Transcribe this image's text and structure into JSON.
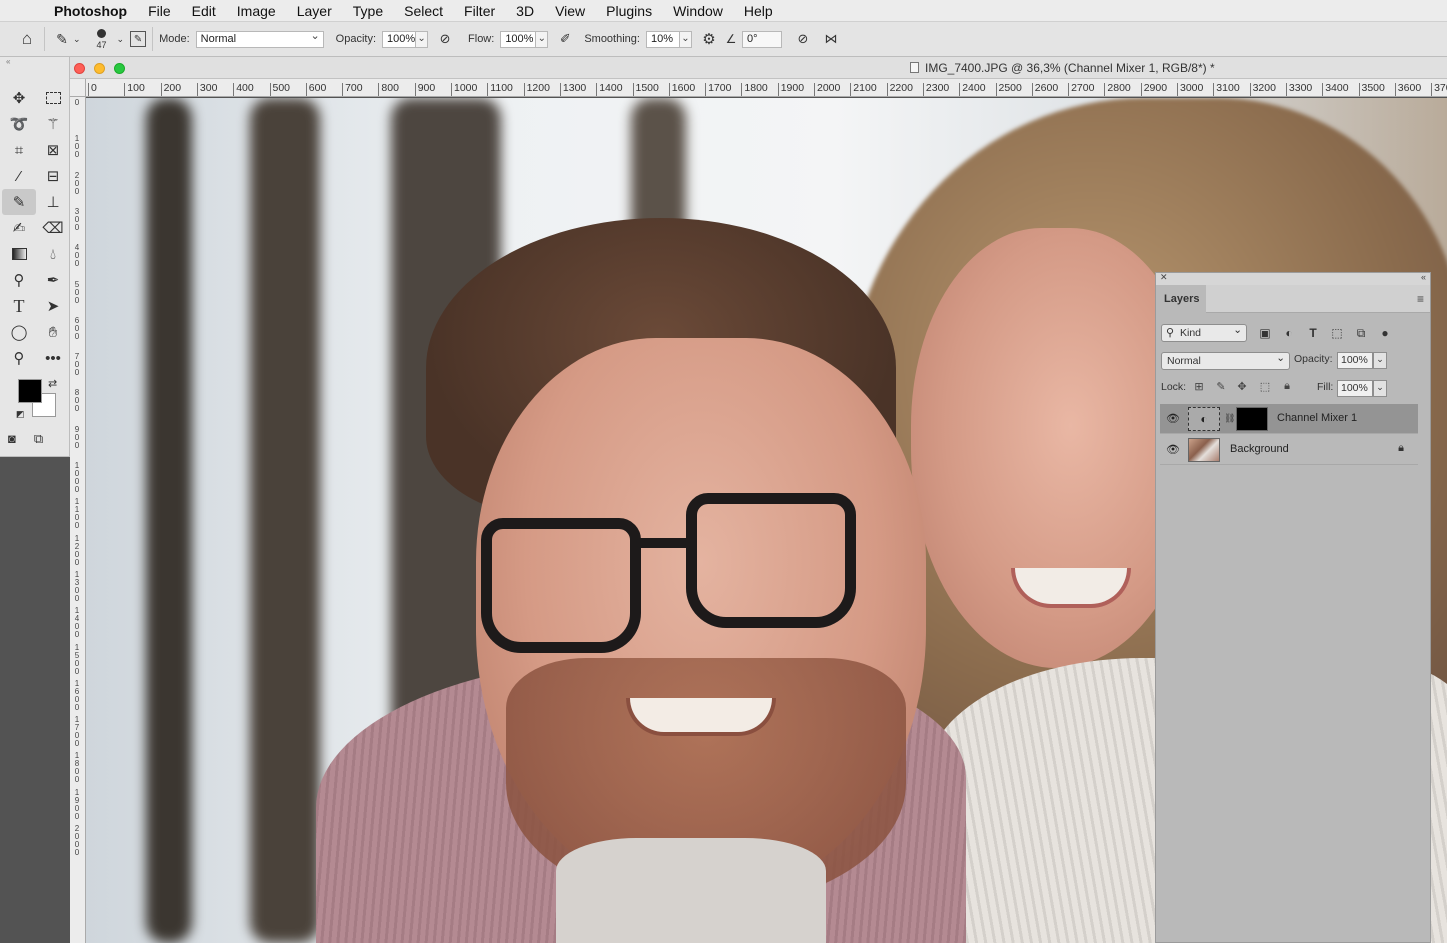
{
  "menubar": {
    "app": "Photoshop",
    "items": [
      "File",
      "Edit",
      "Image",
      "Layer",
      "Type",
      "Select",
      "Filter",
      "3D",
      "View",
      "Plugins",
      "Window",
      "Help"
    ]
  },
  "options_bar": {
    "brush_size": "47",
    "mode_label": "Mode:",
    "mode_value": "Normal",
    "opacity_label": "Opacity:",
    "opacity_value": "100%",
    "flow_label": "Flow:",
    "flow_value": "100%",
    "smoothing_label": "Smoothing:",
    "smoothing_value": "10%",
    "angle_value": "0°"
  },
  "document": {
    "title": "IMG_7400.JPG @ 36,3% (Channel Mixer 1, RGB/8*) *",
    "ruler_top": [
      "0",
      "100",
      "200",
      "300",
      "400",
      "500",
      "600",
      "700",
      "800",
      "900",
      "1000",
      "1100",
      "1200",
      "1300",
      "1400",
      "1500",
      "1600",
      "1700",
      "1800",
      "1900",
      "2000",
      "2100",
      "2200",
      "2300",
      "2400",
      "2500",
      "2600",
      "2700",
      "2800",
      "2900",
      "3000",
      "3100",
      "3200",
      "3300",
      "3400",
      "3500",
      "3600",
      "370"
    ],
    "ruler_left": [
      "0",
      "100",
      "200",
      "300",
      "400",
      "500",
      "600",
      "700",
      "800",
      "900",
      "1000",
      "1100",
      "1200",
      "1300",
      "1400",
      "1500",
      "1600",
      "1700",
      "1800",
      "1900",
      "2000"
    ]
  },
  "layers_panel": {
    "tab": "Layers",
    "filter_kind": "Kind",
    "blend_mode": "Normal",
    "opacity_label": "Opacity:",
    "opacity_value": "100%",
    "lock_label": "Lock:",
    "fill_label": "Fill:",
    "fill_value": "100%",
    "layers": [
      {
        "name": "Channel Mixer 1",
        "selected": true
      },
      {
        "name": "Background",
        "locked": true
      }
    ]
  },
  "tools": {
    "foreground_color": "#000000",
    "background_color": "#ffffff"
  }
}
